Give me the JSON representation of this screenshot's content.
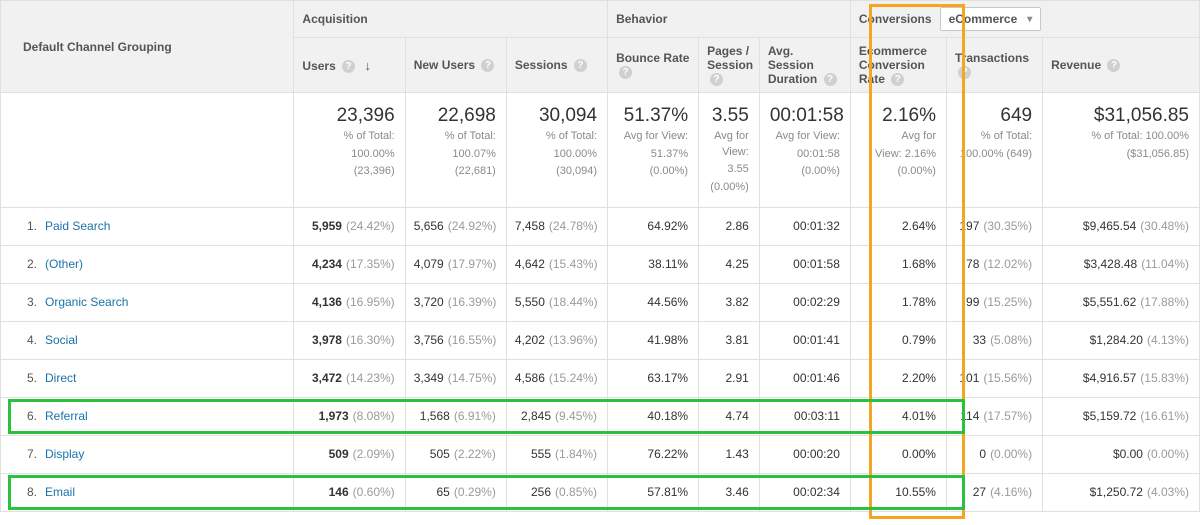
{
  "header": {
    "channel_grouping": "Default Channel Grouping",
    "acquisition": "Acquisition",
    "behavior": "Behavior",
    "conversions": "Conversions",
    "conversions_select": "eCommerce",
    "cols": {
      "users": "Users",
      "new_users": "New Users",
      "sessions": "Sessions",
      "bounce_rate": "Bounce Rate",
      "pages_session": "Pages / Session",
      "avg_session": "Avg. Session Duration",
      "ecr": "Ecommerce Conversion Rate",
      "transactions": "Transactions",
      "revenue": "Revenue"
    }
  },
  "totals": {
    "users": {
      "main": "23,396",
      "sub1": "% of Total:",
      "sub2": "100.00%",
      "sub3": "(23,396)"
    },
    "new_users": {
      "main": "22,698",
      "sub1": "% of Total:",
      "sub2": "100.07%",
      "sub3": "(22,681)"
    },
    "sessions": {
      "main": "30,094",
      "sub1": "% of Total:",
      "sub2": "100.00%",
      "sub3": "(30,094)"
    },
    "bounce_rate": {
      "main": "51.37%",
      "sub1": "Avg for View:",
      "sub2": "51.37%",
      "sub3": "(0.00%)"
    },
    "pages_session": {
      "main": "3.55",
      "sub1": "Avg for View:",
      "sub2": "3.55",
      "sub3": "(0.00%)"
    },
    "avg_session": {
      "main": "00:01:58",
      "sub1": "Avg for View:",
      "sub2": "00:01:58",
      "sub3": "(0.00%)"
    },
    "ecr": {
      "main": "2.16%",
      "sub1": "Avg for",
      "sub2": "View: 2.16%",
      "sub3": "(0.00%)"
    },
    "transactions": {
      "main": "649",
      "sub1": "% of Total:",
      "sub2": "100.00% (649)",
      "sub3": ""
    },
    "revenue": {
      "main": "$31,056.85",
      "sub1": "% of Total: 100.00%",
      "sub2": "($31,056.85)",
      "sub3": ""
    }
  },
  "rows": [
    {
      "idx": "1.",
      "name": "Paid Search",
      "users": "5,959",
      "users_pct": "(24.42%)",
      "new_users": "5,656",
      "new_users_pct": "(24.92%)",
      "sessions": "7,458",
      "sessions_pct": "(24.78%)",
      "bounce": "64.92%",
      "ps": "2.86",
      "dur": "00:01:32",
      "ecr": "2.64%",
      "tx": "197",
      "tx_pct": "(30.35%)",
      "rev": "$9,465.54",
      "rev_pct": "(30.48%)"
    },
    {
      "idx": "2.",
      "name": "(Other)",
      "users": "4,234",
      "users_pct": "(17.35%)",
      "new_users": "4,079",
      "new_users_pct": "(17.97%)",
      "sessions": "4,642",
      "sessions_pct": "(15.43%)",
      "bounce": "38.11%",
      "ps": "4.25",
      "dur": "00:01:58",
      "ecr": "1.68%",
      "tx": "78",
      "tx_pct": "(12.02%)",
      "rev": "$3,428.48",
      "rev_pct": "(11.04%)"
    },
    {
      "idx": "3.",
      "name": "Organic Search",
      "users": "4,136",
      "users_pct": "(16.95%)",
      "new_users": "3,720",
      "new_users_pct": "(16.39%)",
      "sessions": "5,550",
      "sessions_pct": "(18.44%)",
      "bounce": "44.56%",
      "ps": "3.82",
      "dur": "00:02:29",
      "ecr": "1.78%",
      "tx": "99",
      "tx_pct": "(15.25%)",
      "rev": "$5,551.62",
      "rev_pct": "(17.88%)"
    },
    {
      "idx": "4.",
      "name": "Social",
      "users": "3,978",
      "users_pct": "(16.30%)",
      "new_users": "3,756",
      "new_users_pct": "(16.55%)",
      "sessions": "4,202",
      "sessions_pct": "(13.96%)",
      "bounce": "41.98%",
      "ps": "3.81",
      "dur": "00:01:41",
      "ecr": "0.79%",
      "tx": "33",
      "tx_pct": "(5.08%)",
      "rev": "$1,284.20",
      "rev_pct": "(4.13%)"
    },
    {
      "idx": "5.",
      "name": "Direct",
      "users": "3,472",
      "users_pct": "(14.23%)",
      "new_users": "3,349",
      "new_users_pct": "(14.75%)",
      "sessions": "4,586",
      "sessions_pct": "(15.24%)",
      "bounce": "63.17%",
      "ps": "2.91",
      "dur": "00:01:46",
      "ecr": "2.20%",
      "tx": "101",
      "tx_pct": "(15.56%)",
      "rev": "$4,916.57",
      "rev_pct": "(15.83%)"
    },
    {
      "idx": "6.",
      "name": "Referral",
      "users": "1,973",
      "users_pct": "(8.08%)",
      "new_users": "1,568",
      "new_users_pct": "(6.91%)",
      "sessions": "2,845",
      "sessions_pct": "(9.45%)",
      "bounce": "40.18%",
      "ps": "4.74",
      "dur": "00:03:11",
      "ecr": "4.01%",
      "tx": "114",
      "tx_pct": "(17.57%)",
      "rev": "$5,159.72",
      "rev_pct": "(16.61%)"
    },
    {
      "idx": "7.",
      "name": "Display",
      "users": "509",
      "users_pct": "(2.09%)",
      "new_users": "505",
      "new_users_pct": "(2.22%)",
      "sessions": "555",
      "sessions_pct": "(1.84%)",
      "bounce": "76.22%",
      "ps": "1.43",
      "dur": "00:00:20",
      "ecr": "0.00%",
      "tx": "0",
      "tx_pct": "(0.00%)",
      "rev": "$0.00",
      "rev_pct": "(0.00%)"
    },
    {
      "idx": "8.",
      "name": "Email",
      "users": "146",
      "users_pct": "(0.60%)",
      "new_users": "65",
      "new_users_pct": "(0.29%)",
      "sessions": "256",
      "sessions_pct": "(0.85%)",
      "bounce": "57.81%",
      "ps": "3.46",
      "dur": "00:02:34",
      "ecr": "10.55%",
      "tx": "27",
      "tx_pct": "(4.16%)",
      "rev": "$1,250.72",
      "rev_pct": "(4.03%)"
    }
  ]
}
